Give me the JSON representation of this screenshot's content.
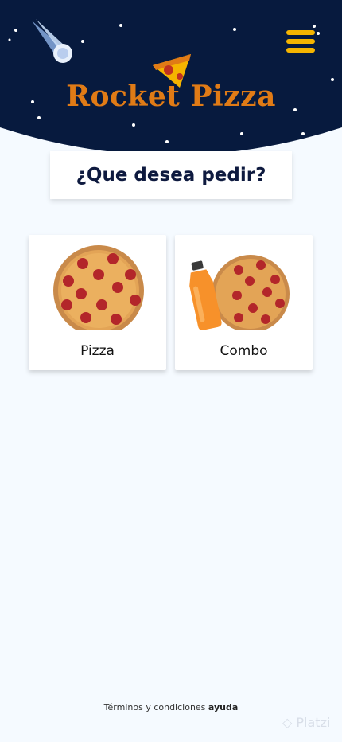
{
  "header": {
    "brand": "Rocket Pizza",
    "menu_icon": "hamburger-menu-icon",
    "background_color": "#071a3e",
    "accent_color": "#f5b400",
    "brand_color": "#e07b16"
  },
  "main": {
    "title": "¿Que desea pedir?",
    "options": [
      {
        "label": "Pizza",
        "icon": "pizza-icon"
      },
      {
        "label": "Combo",
        "icon": "juice-and-pizza-icon"
      }
    ]
  },
  "footer": {
    "terms": "Términos y condiciones",
    "help": "ayuda"
  },
  "watermark": "Platzi"
}
